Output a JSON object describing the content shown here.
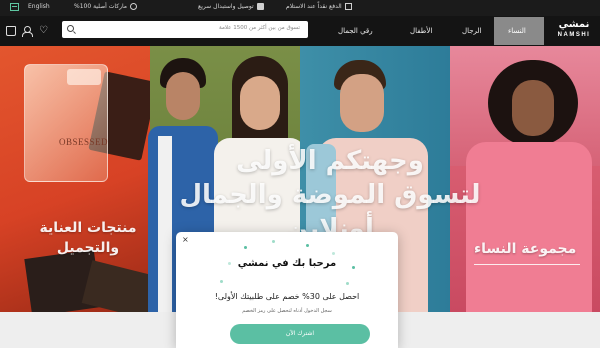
{
  "topbar": {
    "language_label": "English",
    "usp_original": "ماركات أصلية 100%",
    "usp_delivery": "توصيل واستبدال سريع",
    "usp_cod": "الدفع نقداً عند الاستلام"
  },
  "nav": {
    "search_placeholder": "تسوق من بين أكثر من 1500 علامة",
    "links": [
      "رقي الجمال",
      "الأطفال",
      "الرجال",
      "النساء"
    ],
    "logo_ar": "نمشي",
    "logo_en": "NAMSHI"
  },
  "hero": {
    "title_line1": "وجهتكم الأولى",
    "title_line2": "لتسوق الموضة والجمال أونلاين",
    "beauty_label": "منتجات العناية والتجميل",
    "women_label": "مجموعة النساء",
    "perfume_brand": "OBSESSED"
  },
  "popup": {
    "close": "×",
    "title": "مرحبا بك في نمشي",
    "offer": "احصل على 30% خصم على طلبيتك الأولى!",
    "subtitle": "سجل الدخول أدناه لتحصل على رمز الخصم",
    "button": "اشترك الآن"
  },
  "colors": {
    "accent": "#5bbfa3",
    "topbar": "#1b1b1b",
    "nav": "#141414"
  }
}
